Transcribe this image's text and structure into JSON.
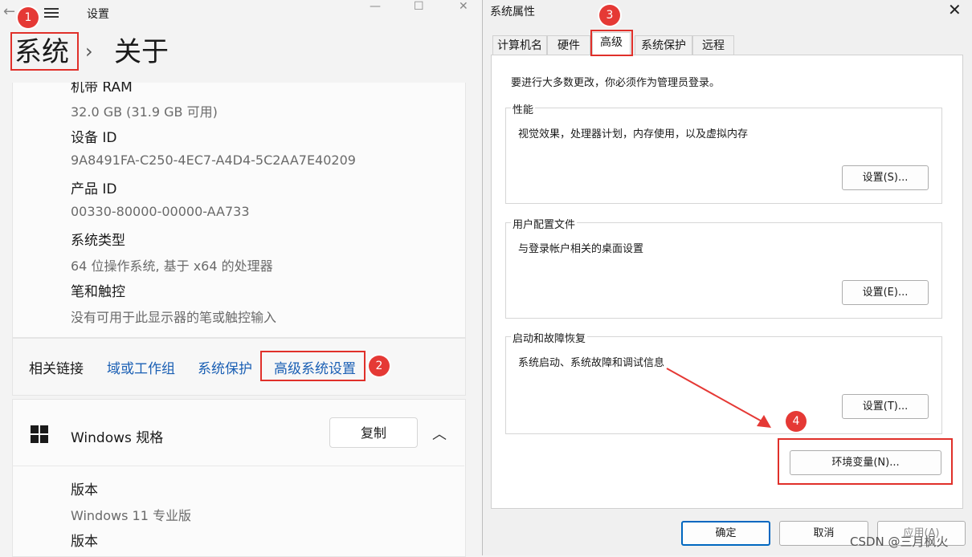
{
  "settings": {
    "title": "设置",
    "back_icon": "←",
    "breadcrumb_parent": "系统",
    "breadcrumb_sep": "›",
    "breadcrumb_current": "关于",
    "specs": [
      {
        "label": "机带 RAM",
        "value": "32.0 GB (31.9 GB 可用)"
      },
      {
        "label": "设备 ID",
        "value": "9A8491FA-C250-4EC7-A4D4-5C2AA7E40209"
      },
      {
        "label": "产品 ID",
        "value": "00330-80000-00000-AA733"
      },
      {
        "label": "系统类型",
        "value": "64 位操作系统, 基于 x64 的处理器"
      },
      {
        "label": "笔和触控",
        "value": "没有可用于此显示器的笔或触控输入"
      }
    ],
    "related_links": {
      "label": "相关链接",
      "items": [
        "域或工作组",
        "系统保护",
        "高级系统设置"
      ]
    },
    "windows_spec": {
      "title": "Windows 规格",
      "copy_label": "复制",
      "edition_label": "版本",
      "edition_value": "Windows 11 专业版",
      "version_label": "版本"
    }
  },
  "dialog": {
    "title": "系统属性",
    "close_icon": "✕",
    "tabs": [
      "计算机名",
      "硬件",
      "高级",
      "系统保护",
      "远程"
    ],
    "admin_note": "要进行大多数更改，你必须作为管理员登录。",
    "groups": [
      {
        "title": "性能",
        "desc": "视觉效果，处理器计划，内存使用，以及虚拟内存",
        "button": "设置(S)..."
      },
      {
        "title": "用户配置文件",
        "desc": "与登录帐户相关的桌面设置",
        "button": "设置(E)..."
      },
      {
        "title": "启动和故障恢复",
        "desc": "系统启动、系统故障和调试信息",
        "button": "设置(T)..."
      }
    ],
    "env_button": "环境变量(N)...",
    "ok": "确定",
    "cancel": "取消",
    "apply": "应用(A)"
  },
  "annotations": {
    "badges": [
      "1",
      "2",
      "3",
      "4"
    ],
    "color": "#e53935"
  },
  "watermark": "CSDN @三月枫火"
}
